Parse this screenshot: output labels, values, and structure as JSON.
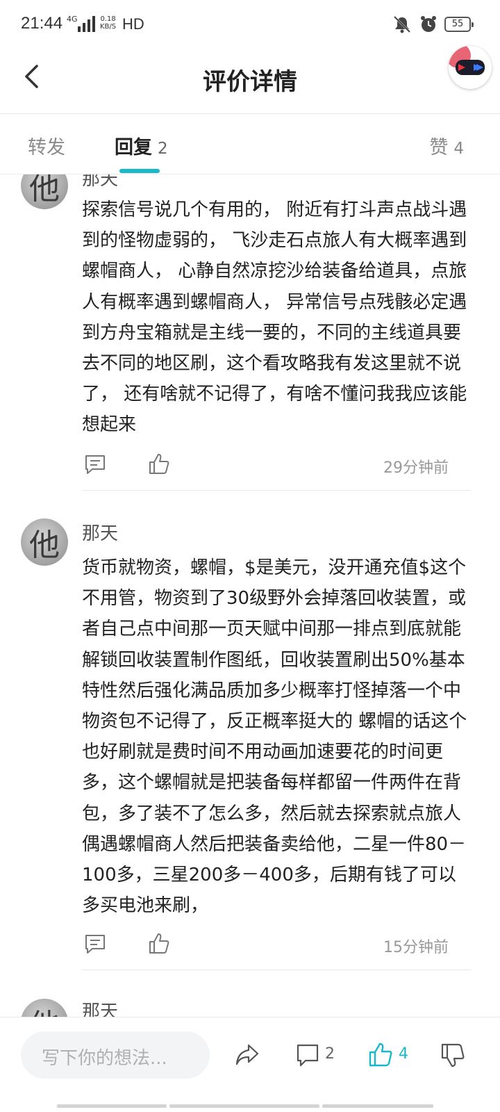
{
  "status_bar": {
    "time": "21:44",
    "network": "4G",
    "speed_value": "0.18",
    "speed_unit": "KB/S",
    "hd": "HD",
    "battery": "55"
  },
  "header": {
    "title": "评价详情"
  },
  "tabs": {
    "forward_label": "转发",
    "reply_label": "回复",
    "reply_count": "2",
    "like_label": "赞",
    "like_count": "4"
  },
  "comments": [
    {
      "avatar_char": "他",
      "username": "那天",
      "text": "探索信号说几个有用的， 附近有打斗声点战斗遇到的怪物虚弱的， 飞沙走石点旅人有大概率遇到螺帽商人， 心静自然凉挖沙给装备给道具，点旅人有概率遇到螺帽商人， 异常信号点残骸必定遇到方舟宝箱就是主线一要的，不同的主线道具要去不同的地区刷，这个看攻略我有发这里就不说了， 还有啥就不记得了，有啥不懂问我我应该能想起来",
      "time": "29分钟前"
    },
    {
      "avatar_char": "他",
      "username": "那天",
      "text": "货币就物资，螺帽，$是美元，没开通充值$这个不用管，物资到了30级野外会掉落回收装置，或者自己点中间那一页天赋中间那一排点到底就能解锁回收装置制作图纸，回收装置刷出50%基本特性然后强化满品质加多少概率打怪掉落一个中物资包不记得了，反正概率挺大的 螺帽的话这个也好刷就是费时间不用动画加速要花的时间更多，这个螺帽就是把装备每样都留一件两件在背包，多了装不了怎么多，然后就去探索就点旅人偶遇螺帽商人然后把装备卖给他，二星一件80－100多，三星200多－400多，后期有钱了可以多买电池来刷，",
      "time": "15分钟前"
    },
    {
      "avatar_char": "他",
      "username": "那天"
    }
  ],
  "bottom_bar": {
    "input_placeholder": "写下你的想法...",
    "comment_count": "2",
    "like_count": "4"
  },
  "colors": {
    "accent": "#17b8c9",
    "text": "#222222",
    "muted": "#999999"
  }
}
